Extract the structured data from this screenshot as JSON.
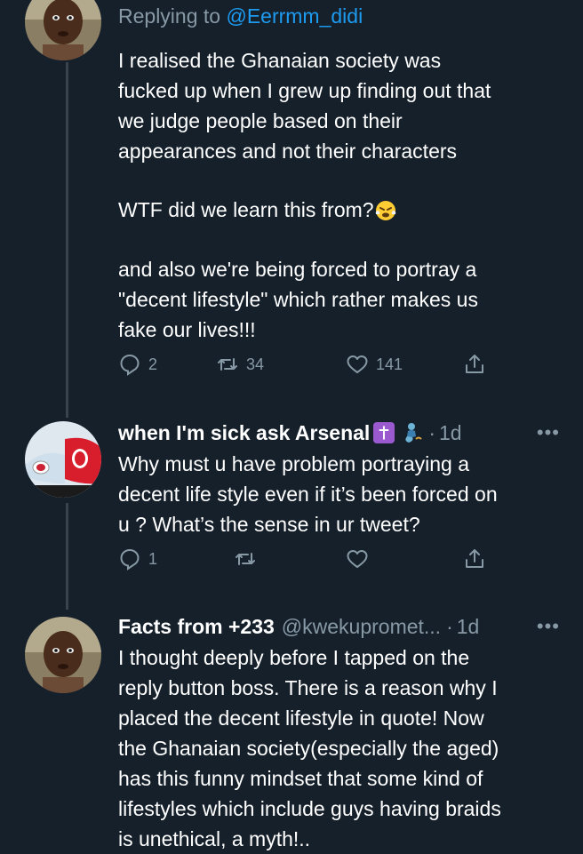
{
  "tweets": [
    {
      "replying_prefix": "Replying to ",
      "replying_handle": "@Eerrmm_didi",
      "text_p1": "I realised the Ghanaian society was\nfucked up when I grew up finding out that\nwe judge people based on their\nappearances and not their characters",
      "text_p2": "WTF did we learn this from?",
      "text_p2_emoji": "face-with-steam-icon",
      "text_p3": "and also we're being forced to portray a\n\"decent lifestyle\" which rather makes us\nfake our lives!!!",
      "replies": "2",
      "retweets": "34",
      "likes": "141"
    },
    {
      "display_name": "when I'm sick ask Arsenal",
      "badges": [
        "cross-icon",
        "genie-icon"
      ],
      "separator": "·",
      "time": "1d",
      "more": "•••",
      "text": "Why must u have problem portraying a\ndecent life style even if it’s been forced on\nu ? What’s the sense in ur tweet?",
      "replies": "1",
      "retweets": "",
      "likes": ""
    },
    {
      "display_name": "Facts from +233",
      "username": "@kwekupromet...",
      "separator": "·",
      "time": "1d",
      "more": "•••",
      "text": "I thought deeply before I tapped on the\nreply button boss. There is a reason why I\nplaced the decent lifestyle in quote! Now\nthe Ghanaian society(especially the aged)\nhas this funny mindset that some kind of\nlifestyles which include guys having braids\nis unethical, a myth!.."
    }
  ],
  "colors": {
    "background": "#15202b",
    "text": "#ffffff",
    "secondary": "#8899a6",
    "link": "#1d9bf0",
    "thread_line": "#38444d"
  }
}
